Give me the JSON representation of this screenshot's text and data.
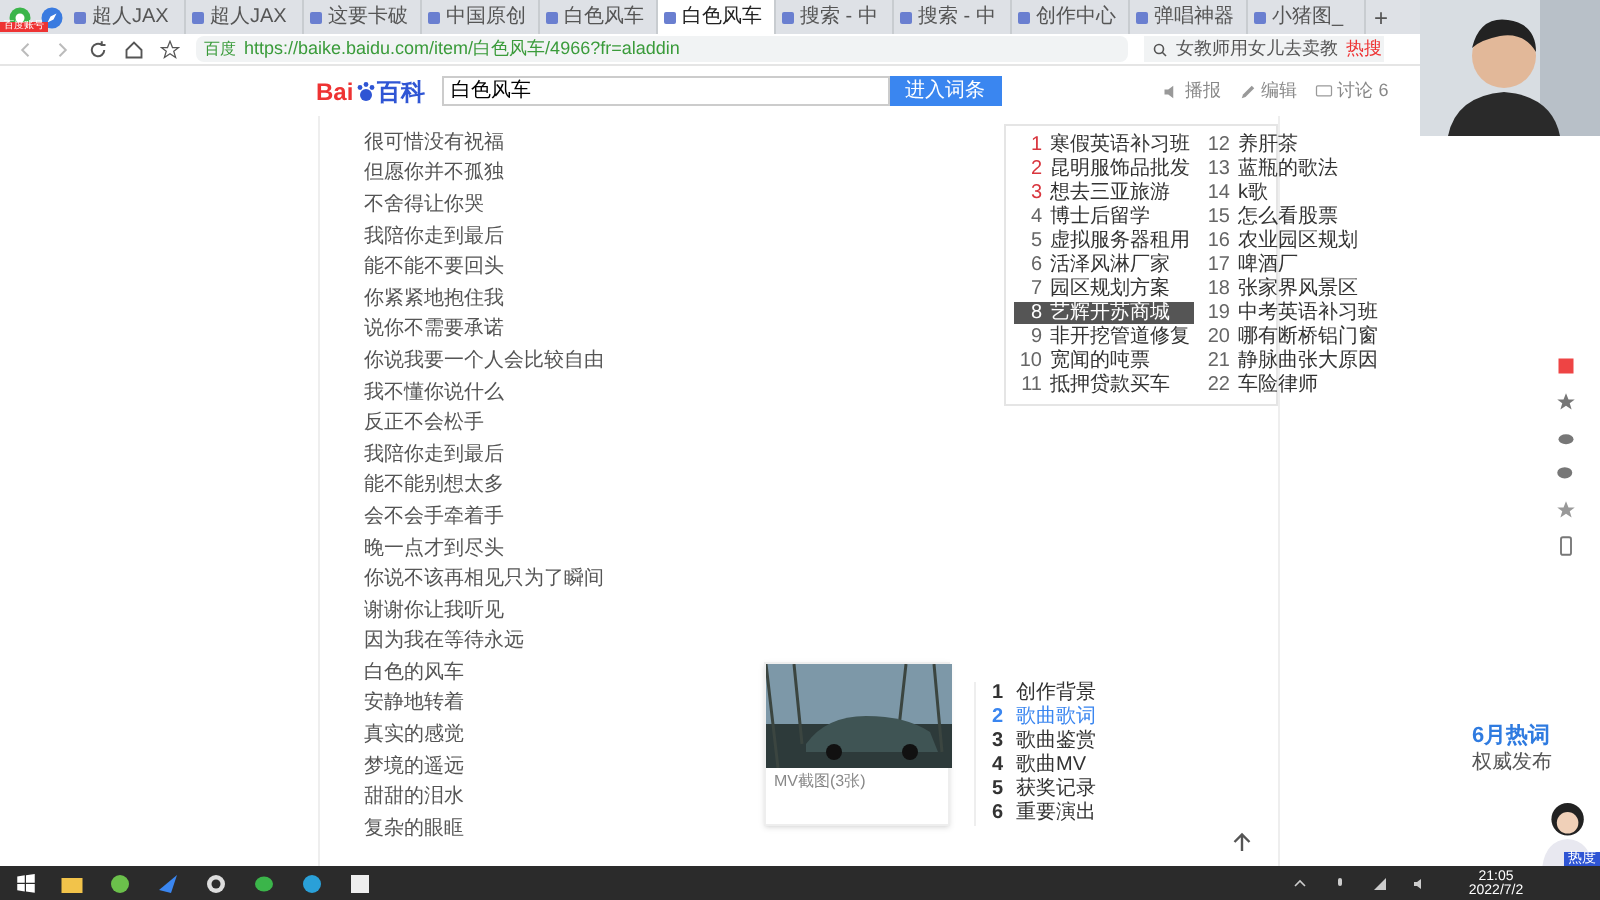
{
  "browser": {
    "badge": "百度账号",
    "tabs": [
      {
        "title": "超人JAX",
        "selected": false
      },
      {
        "title": "超人JAX",
        "selected": false
      },
      {
        "title": "这要卡破",
        "selected": false
      },
      {
        "title": "中国原创",
        "selected": false
      },
      {
        "title": "白色风车",
        "selected": false
      },
      {
        "title": "白色风车",
        "selected": true
      },
      {
        "title": "搜索 - 中",
        "selected": false
      },
      {
        "title": "搜索 - 中",
        "selected": false
      },
      {
        "title": "创作中心",
        "selected": false
      },
      {
        "title": "弹唱神器",
        "selected": false
      },
      {
        "title": "小猪图_",
        "selected": false
      }
    ],
    "new_tab": "+",
    "site_label": "百度",
    "url": "https://baike.baidu.com/item/白色风车/4966?fr=aladdin",
    "search_placeholder": "女教师用女儿去卖教",
    "hot_label": "热搜"
  },
  "header": {
    "logo_left": "Bai",
    "logo_right": "百科",
    "search_value": "白色风车",
    "search_button": "进入词条",
    "actions": [
      {
        "kind": "speaker",
        "label": "播报"
      },
      {
        "kind": "edit",
        "label": "编辑"
      },
      {
        "kind": "discuss",
        "label": "讨论 6"
      }
    ]
  },
  "lyrics": [
    "很可惜没有祝福",
    "但愿你并不孤独",
    "不舍得让你哭",
    "我陪你走到最后",
    "能不能不要回头",
    "你紧紧地抱住我",
    "说你不需要承诺",
    "你说我要一个人会比较自由",
    "我不懂你说什么",
    "反正不会松手",
    "我陪你走到最后",
    "能不能别想太多",
    "会不会手牵着手",
    "晚一点才到尽头",
    "你说不该再相见只为了瞬间",
    "谢谢你让我听见",
    "因为我在等待永远",
    "白色的风车",
    "安静地转着",
    "真实的感觉",
    "梦境的遥远",
    "甜甜的泪水",
    "复杂的眼眶"
  ],
  "ads": {
    "items": [
      {
        "num": "1",
        "text": "寒假英语补习班",
        "color": "#d9363e",
        "selected": false
      },
      {
        "num": "2",
        "text": "昆明服饰品批发",
        "color": "#d9363e",
        "selected": false
      },
      {
        "num": "3",
        "text": "想去三亚旅游",
        "color": "#d9363e",
        "selected": false
      },
      {
        "num": "4",
        "text": "博士后留学",
        "color": "#666666",
        "selected": false
      },
      {
        "num": "5",
        "text": "虚拟服务器租用",
        "color": "#666666",
        "selected": false
      },
      {
        "num": "6",
        "text": "活泽风淋厂家",
        "color": "#666666",
        "selected": false
      },
      {
        "num": "7",
        "text": "园区规划方案",
        "color": "#666666",
        "selected": false
      },
      {
        "num": "8",
        "text": "艺辉开苏商城",
        "selected": true
      },
      {
        "num": "9",
        "text": "非开挖管道修复",
        "color": "#666666",
        "selected": false
      },
      {
        "num": "10",
        "text": "宽闻的吨票",
        "color": "#666666",
        "selected": false
      },
      {
        "num": "11",
        "text": "抵押贷款买车",
        "color": "#666666",
        "selected": false
      },
      {
        "num": "12",
        "text": "养肝茶",
        "color": "#666666",
        "selected": false
      },
      {
        "num": "13",
        "text": "蓝瓶的歌法",
        "color": "#666666",
        "selected": false
      },
      {
        "num": "14",
        "text": "k歌",
        "color": "#666666",
        "selected": false
      },
      {
        "num": "15",
        "text": "怎么看股票",
        "color": "#666666",
        "selected": false
      },
      {
        "num": "16",
        "text": "农业园区规划",
        "color": "#666666",
        "selected": false
      },
      {
        "num": "17",
        "text": "啤酒厂",
        "color": "#666666",
        "selected": false
      },
      {
        "num": "18",
        "text": "张家界风景区",
        "color": "#666666",
        "selected": false
      },
      {
        "num": "19",
        "text": "中考英语补习班",
        "color": "#666666",
        "selected": false
      },
      {
        "num": "20",
        "text": "哪有断桥铝门窗",
        "color": "#666666",
        "selected": false
      },
      {
        "num": "21",
        "text": "静脉曲张大原因",
        "color": "#666666",
        "selected": false
      },
      {
        "num": "22",
        "text": "车险律师",
        "color": "#666666",
        "selected": false
      }
    ]
  },
  "media": {
    "kind": "picture",
    "caption": "MV截图(3张)"
  },
  "catalog": [
    {
      "num": "1",
      "label": "创作背景",
      "selected": false
    },
    {
      "num": "2",
      "label": "歌曲歌词",
      "selected": true
    },
    {
      "num": "3",
      "label": "歌曲鉴赏",
      "selected": false
    },
    {
      "num": "4",
      "label": "歌曲MV",
      "selected": false
    },
    {
      "num": "5",
      "label": "获奖记录",
      "selected": false
    },
    {
      "num": "6",
      "label": "重要演出",
      "selected": false
    }
  ],
  "promo": {
    "title": "6月热词",
    "subtitle": "权威发布",
    "tag": "热度"
  },
  "taskbar": {
    "time": "21:05",
    "date": "2022/7/2"
  }
}
